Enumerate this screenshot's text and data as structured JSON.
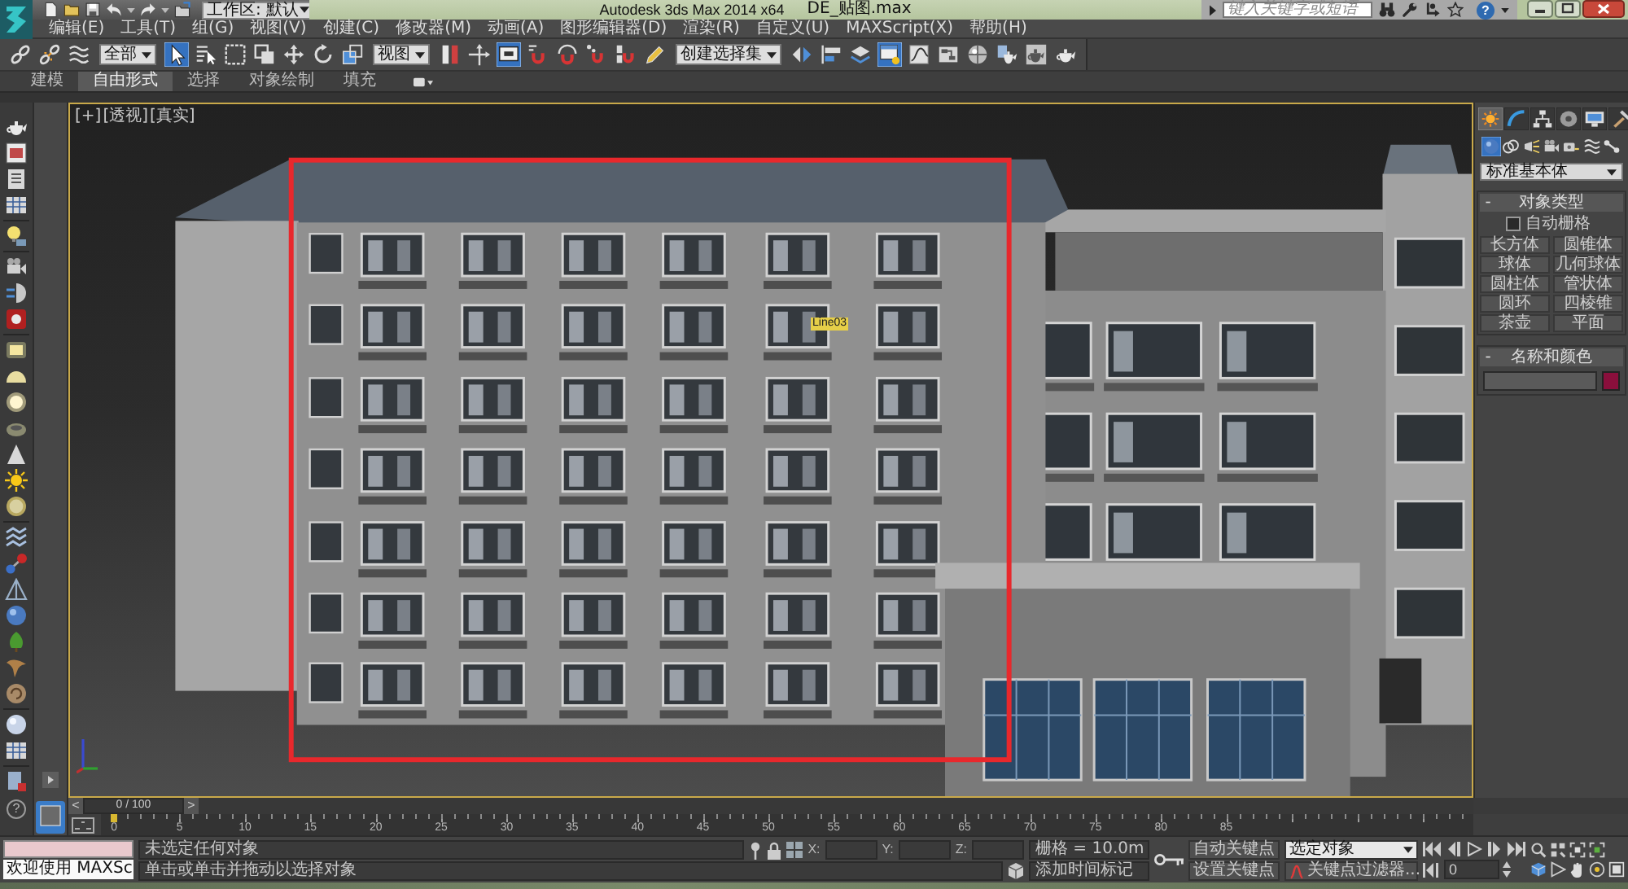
{
  "title_bar": {
    "workspace": "工作区: 默认",
    "app_title": "Autodesk 3ds Max  2014 x64",
    "file_name": "DE_贴图.max",
    "search": {
      "placeholder": "键入关键字或短语"
    },
    "help": "?"
  },
  "menu_bar": [
    "编辑(E)",
    "工具(T)",
    "组(G)",
    "视图(V)",
    "创建(C)",
    "修改器(M)",
    "动画(A)",
    "图形编辑器(D)",
    "渲染(R)",
    "自定义(U)",
    "MAXScript(X)",
    "帮助(H)"
  ],
  "main_toolbar": [
    {
      "kind": "button",
      "selected": false
    },
    {
      "kind": "button",
      "selected": false
    },
    {
      "kind": "button",
      "selected": false
    },
    {
      "kind": "dropdown",
      "value": "全部"
    },
    {
      "kind": "button",
      "selected": true
    },
    {
      "kind": "button",
      "selected": false
    },
    {
      "kind": "button",
      "selected": false
    },
    {
      "kind": "button",
      "selected": false
    },
    {
      "kind": "button",
      "selected": false
    },
    {
      "kind": "button",
      "selected": false
    },
    {
      "kind": "button",
      "selected": false
    },
    {
      "kind": "dropdown",
      "value": "视图"
    },
    {
      "kind": "button",
      "selected": false
    },
    {
      "kind": "button",
      "selected": false
    },
    {
      "kind": "button",
      "selected": true
    },
    {
      "kind": "button",
      "selected": false
    },
    {
      "kind": "button",
      "selected": false
    },
    {
      "kind": "button",
      "selected": false
    },
    {
      "kind": "button",
      "selected": false
    },
    {
      "kind": "button",
      "selected": false
    },
    {
      "kind": "dropdown",
      "value": "创建选择集"
    },
    {
      "kind": "button",
      "selected": false
    },
    {
      "kind": "button",
      "selected": false
    },
    {
      "kind": "button",
      "selected": false
    },
    {
      "kind": "button",
      "selected": true
    },
    {
      "kind": "button",
      "selected": false
    },
    {
      "kind": "button",
      "selected": false
    },
    {
      "kind": "button",
      "selected": false
    },
    {
      "kind": "button",
      "selected": false
    },
    {
      "kind": "button",
      "selected": false
    },
    {
      "kind": "button",
      "selected": false
    }
  ],
  "ribbon": {
    "tabs": [
      {
        "label": "建模",
        "selected": false
      },
      {
        "label": "自由形式",
        "selected": true
      },
      {
        "label": "选择",
        "selected": false
      },
      {
        "label": "对象绘制",
        "selected": false
      },
      {
        "label": "填充",
        "selected": false
      }
    ]
  },
  "left_toolbar": {
    "help": "?"
  },
  "viewport": {
    "menus": [
      "[+]",
      "[透视]",
      "[真实]"
    ],
    "object_label": "Line03"
  },
  "command_panel": {
    "tabs": [
      {
        "selected": true
      },
      {
        "selected": false
      },
      {
        "selected": false
      },
      {
        "selected": false
      },
      {
        "selected": false
      },
      {
        "selected": false
      }
    ],
    "categories": [
      {
        "selected": true
      },
      {
        "selected": false
      },
      {
        "selected": false
      },
      {
        "selected": false
      },
      {
        "selected": false
      },
      {
        "selected": false
      },
      {
        "selected": false
      }
    ],
    "dropdown": "标准基本体",
    "object_type": {
      "toggle": "-",
      "title": "对象类型",
      "auto_grid": {
        "label": "自动栅格",
        "checked": false
      },
      "buttons": [
        "长方体",
        "圆锥体",
        "球体",
        "几何球体",
        "圆柱体",
        "管状体",
        "圆环",
        "四棱锥",
        "茶壶",
        "平面"
      ]
    },
    "name_and_color": {
      "toggle": "-",
      "title": "名称和颜色",
      "color": "#8a0f3c"
    }
  },
  "time_slider": {
    "previous": "<",
    "position": "0 / 100",
    "next": ">",
    "level": 0
  },
  "track_bar": {
    "labels": [
      "0",
      "5",
      "10",
      "15",
      "20",
      "25",
      "30",
      "35",
      "40",
      "45",
      "50",
      "55",
      "60",
      "65",
      "70",
      "75",
      "80",
      "85"
    ]
  },
  "status_bar": {
    "listener_output": "欢迎使用 MAXSc",
    "prompt": "未选定任何对象",
    "hint": "单击或单击并拖动以选择对象",
    "axes": [
      "X:",
      "Y:",
      "Z:"
    ],
    "grid": "栅格 = 10.0m",
    "time_tag": "添加时间标记",
    "auto_key": "自动关键点",
    "set_key": "设置关键点",
    "key_mode": "选定对象",
    "key_filters": "关键点过滤器...",
    "current_frame": "0"
  }
}
